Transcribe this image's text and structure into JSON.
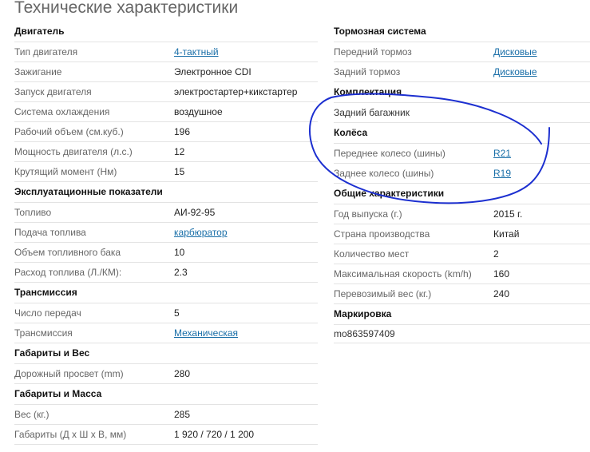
{
  "page": {
    "title": "Технические характеристики"
  },
  "left_sections": [
    {
      "title": "Двигатель",
      "rows": [
        {
          "label": "Тип двигателя",
          "value": "4-тактный",
          "link": true
        },
        {
          "label": "Зажигание",
          "value": "Электронное CDI",
          "link": false
        },
        {
          "label": "Запуск двигателя",
          "value": "электростартер+кикстартер",
          "link": false
        },
        {
          "label": "Система охлаждения",
          "value": "воздушное",
          "link": false
        },
        {
          "label": "Рабочий объем (см.куб.)",
          "value": "196",
          "link": false
        },
        {
          "label": "Мощность двигателя (л.с.)",
          "value": "12",
          "link": false
        },
        {
          "label": "Крутящий момент (Нм)",
          "value": "15",
          "link": false
        }
      ]
    },
    {
      "title": "Эксплуатационные показатели",
      "rows": [
        {
          "label": "Топливо",
          "value": "АИ-92-95",
          "link": false
        },
        {
          "label": "Подача топлива",
          "value": "карбюратор",
          "link": true
        },
        {
          "label": "Объем топливного бака",
          "value": "10",
          "link": false
        },
        {
          "label": "Расход топлива (Л./КМ):",
          "value": "2.3",
          "link": false
        }
      ]
    },
    {
      "title": "Трансмиссия",
      "rows": [
        {
          "label": "Число передач",
          "value": "5",
          "link": false
        },
        {
          "label": "Трансмиссия",
          "value": "Механическая",
          "link": true
        }
      ]
    },
    {
      "title": "Габариты и Вес",
      "rows": [
        {
          "label": "Дорожный просвет (mm)",
          "value": "280",
          "link": false
        }
      ]
    },
    {
      "title": "Габариты и Масса",
      "rows": [
        {
          "label": "Вес (кг.)",
          "value": "285",
          "link": false
        },
        {
          "label": "Габариты (Д x Ш x В, мм)",
          "value": "1 920 / 720 / 1 200",
          "link": false
        }
      ]
    }
  ],
  "right_sections": [
    {
      "title": "Тормозная система",
      "rows": [
        {
          "label": "Передний тормоз",
          "value": "Дисковые",
          "link": true
        },
        {
          "label": "Задний тормоз",
          "value": "Дисковые",
          "link": true
        }
      ]
    },
    {
      "title": "Комплектация",
      "rows": [
        {
          "label": "Задний багажник",
          "value": "",
          "link": false
        }
      ]
    },
    {
      "title": "Колёса",
      "rows": [
        {
          "label": "Переднее колесо (шины)",
          "value": "R21",
          "link": true
        },
        {
          "label": "Заднее колесо (шины)",
          "value": "R19",
          "link": true
        }
      ]
    },
    {
      "title": "Общие характеристики",
      "rows": [
        {
          "label": "Год выпуска (г.)",
          "value": "2015 г.",
          "link": false
        },
        {
          "label": "Страна производства",
          "value": "Китай",
          "link": false
        },
        {
          "label": "Количество мест",
          "value": "2",
          "link": false
        },
        {
          "label": "Максимальная скорость (km/h)",
          "value": "160",
          "link": false
        },
        {
          "label": "Перевозимый вес (кг.)",
          "value": "240",
          "link": false
        }
      ]
    }
  ],
  "marking": {
    "title": "Маркировка",
    "value": "mo863597409"
  },
  "colors": {
    "link": "#1a6fa8",
    "annotation_stroke": "#1c2fd0",
    "divider": "#e3e3e3"
  }
}
